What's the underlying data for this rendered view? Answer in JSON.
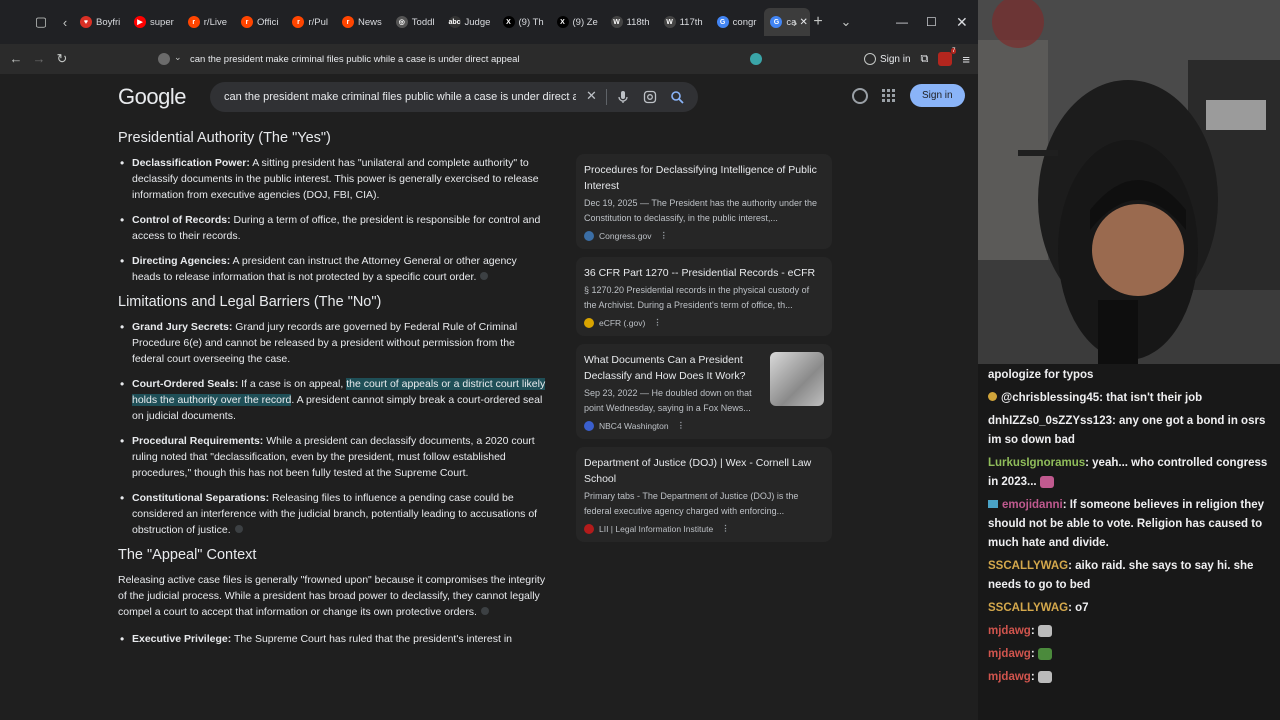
{
  "browser": {
    "tabs": [
      {
        "label": "Boyfri",
        "color": "#d93025",
        "glyph": "♥"
      },
      {
        "label": "super",
        "color": "#ff0000",
        "glyph": "▶"
      },
      {
        "label": "r/Live",
        "color": "#ff4500",
        "glyph": "r"
      },
      {
        "label": "Offici",
        "color": "#ff4500",
        "glyph": "r"
      },
      {
        "label": "r/Pul",
        "color": "#ff4500",
        "glyph": "r"
      },
      {
        "label": "News",
        "color": "#ff4500",
        "glyph": "r"
      },
      {
        "label": "Toddl",
        "color": "#555555",
        "glyph": "◎"
      },
      {
        "label": "Judge",
        "color": "#333333",
        "glyph": "abc"
      },
      {
        "label": "(9) Th",
        "color": "#000000",
        "glyph": "X"
      },
      {
        "label": "(9) Ze",
        "color": "#000000",
        "glyph": "X"
      },
      {
        "label": "118th",
        "color": "#444444",
        "glyph": "W"
      },
      {
        "label": "117th",
        "color": "#444444",
        "glyph": "W"
      },
      {
        "label": "congr",
        "color": "#4285f4",
        "glyph": "G"
      }
    ],
    "active_tab": {
      "label": "ca",
      "color": "#4285f4",
      "glyph": "G"
    },
    "url": "can the president make criminal files public while a case is under direct appeal",
    "toolbar_sign_in": "Sign in",
    "extension_badge": "7"
  },
  "google": {
    "logo": "Google",
    "query": "can the president make criminal files public while a case is under direct a",
    "sign_in": "Sign in"
  },
  "article": {
    "s1_title": "Presidential Authority (The \"Yes\")",
    "s1_items": [
      {
        "bold": "Declassification Power:",
        "text": " A sitting president has \"unilateral and complete authority\" to declassify documents in the public interest. This power is generally exercised to release information from executive agencies (DOJ, FBI, CIA)."
      },
      {
        "bold": "Control of Records:",
        "text": " During a term of office, the president is responsible for control and access to their records."
      },
      {
        "bold": "Directing Agencies:",
        "text": " A president can instruct the Attorney General or other agency heads to release information that is not protected by a specific court order."
      }
    ],
    "s2_title": "Limitations and Legal Barriers (The \"No\")",
    "s2_items": [
      {
        "bold": "Grand Jury Secrets:",
        "text": " Grand jury records are governed by Federal Rule of Criminal Procedure 6(e) and cannot be released by a president without permission from the federal court overseeing the case."
      },
      {
        "bold": "Court-Ordered Seals:",
        "pre": " If a case is on appeal, ",
        "hl": "the court of appeals or a district court likely holds the authority over the record",
        "post": ". A president cannot simply break a court-ordered seal on judicial documents."
      },
      {
        "bold": "Procedural Requirements:",
        "text": " While a president can declassify documents, a 2020 court ruling noted that \"declassification, even by the president, must follow established procedures,\" though this has not been fully tested at the Supreme Court."
      },
      {
        "bold": "Constitutional Separations:",
        "text": " Releasing files to influence a pending case could be considered an interference with the judicial branch, potentially leading to accusations of obstruction of justice."
      }
    ],
    "s3_title": "The \"Appeal\" Context",
    "s3_para": "Releasing active case files is generally \"frowned upon\" because it compromises the integrity of the judicial process. While a president has broad power to declassify, they cannot legally compel a court to accept that information or change its own protective orders.",
    "s3_item": {
      "bold": "Executive Privilege:",
      "text": " The Supreme Court has ruled that the president's interest in"
    }
  },
  "sources": [
    {
      "title": "Procedures for Declassifying Intelligence of Public Interest",
      "snippet": "Dec 19, 2025 — The President has the authority under the Constitution to declassify, in the public interest,...",
      "site": "Congress.gov",
      "color": "#3b6ea5"
    },
    {
      "title": "36 CFR Part 1270 -- Presidential Records - eCFR",
      "snippet": "§ 1270.20 Presidential records in the physical custody of the Archivist. During a President's term of office, th...",
      "site": "eCFR (.gov)",
      "color": "#d9a400"
    },
    {
      "title": "What Documents Can a President Declassify and How Does It Work?",
      "snippet": "Sep 23, 2022 — He doubled down on that point Wednesday, saying in a Fox News...",
      "site": "NBC4 Washington",
      "color": "#3a5fcd"
    },
    {
      "title": "Department of Justice (DOJ) | Wex - Cornell Law School",
      "snippet": "Primary tabs - The Department of Justice (DOJ) is the federal executive agency charged with enforcing...",
      "site": "LII | Legal Information Institute",
      "color": "#b31b1b"
    }
  ],
  "chat": [
    {
      "user": "",
      "text": "apologize for typos",
      "color": "#efeff1"
    },
    {
      "user": "@chrisblessing45",
      "text": ": that isn't their job",
      "color": "#efeff1"
    },
    {
      "user": "dnhIZZs0_0sZZYss123",
      "text": ": any one got a bond in osrs im so down bad",
      "color": "#efeff1"
    },
    {
      "user": "LurkusIgnoramus",
      "text": ": yeah... who controlled congress in 2023...",
      "color": "#8fbc5a"
    },
    {
      "user": "emojidanni",
      "text": ": If someone believes in religion they should not be able to vote. Religion has caused to much hate and divide.",
      "color": "#c05a8f"
    },
    {
      "user": "SSCALLYWAG",
      "text": ": aiko raid. she says to say hi. she needs to go to bed",
      "color": "#d4a84c"
    },
    {
      "user": "SSCALLYWAG",
      "text": ": o7",
      "color": "#d4a84c"
    },
    {
      "user": "mjdawg",
      "text": ":",
      "color": "#d0544d"
    },
    {
      "user": "mjdawg",
      "text": ":",
      "color": "#d0544d"
    },
    {
      "user": "mjdawg",
      "text": ":",
      "color": "#d0544d"
    }
  ]
}
